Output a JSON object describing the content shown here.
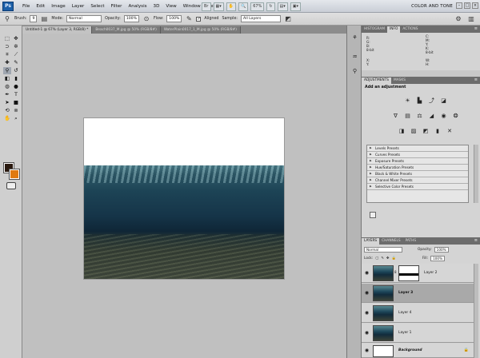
{
  "app": {
    "logo": "Ps",
    "menu": [
      "File",
      "Edit",
      "Image",
      "Layer",
      "Select",
      "Filter",
      "Analysis",
      "3D",
      "View",
      "Window",
      "Help"
    ],
    "zoom": "67%",
    "workspace": "COLOR AND TONE",
    "window_controls": [
      "–",
      "□",
      "×"
    ]
  },
  "options": {
    "brush_label": "Brush:",
    "brush_size": "9",
    "mode_label": "Mode:",
    "mode_value": "Normal",
    "opacity_label": "Opacity:",
    "opacity_value": "100%",
    "flow_label": "Flow:",
    "flow_value": "100%",
    "aligned_label": "Aligned",
    "sample_label": "Sample:",
    "sample_value": "All Layers"
  },
  "tabs": [
    "Untitled-1 @ 67% (Layer 3, RGB/8) *",
    "Beach0037_M.jpg @ 50% (RGB/8#)",
    "WaterPlain0017_1_M.jpg @ 50% (RGB/8#)"
  ],
  "panels": {
    "top_tabs": [
      "HISTOGRAM",
      "INFO",
      "ACTIONS"
    ],
    "info": {
      "rgb": "R:\nG:\nB:\n8-bit",
      "cmyk": "C:\nM:\nY:\nK:\n8-bit",
      "xy": "X:\nY:",
      "wh": "W:\nH:"
    },
    "adj_tabs": [
      "ADJUSTMENTS",
      "MASKS"
    ],
    "adj_title": "Add an adjustment",
    "presets": [
      "Levels Presets",
      "Curves Presets",
      "Exposure Presets",
      "Hue/Saturation Presets",
      "Black & White Presets",
      "Channel Mixer Presets",
      "Selective Color Presets"
    ],
    "layer_tabs": [
      "LAYERS",
      "CHANNELS",
      "PATHS"
    ],
    "blend_mode": "Normal",
    "opacity_label": "Opacity:",
    "opacity_value": "100%",
    "lock_label": "Lock:",
    "fill_label": "Fill:",
    "fill_value": "100%",
    "layers": [
      {
        "name": "Layer 2"
      },
      {
        "name": "Layer 3"
      },
      {
        "name": "Layer 4"
      },
      {
        "name": "Layer 1"
      },
      {
        "name": "Background"
      }
    ]
  },
  "colors": {
    "foreground": "#2a1a10",
    "background": "#e07a10"
  }
}
